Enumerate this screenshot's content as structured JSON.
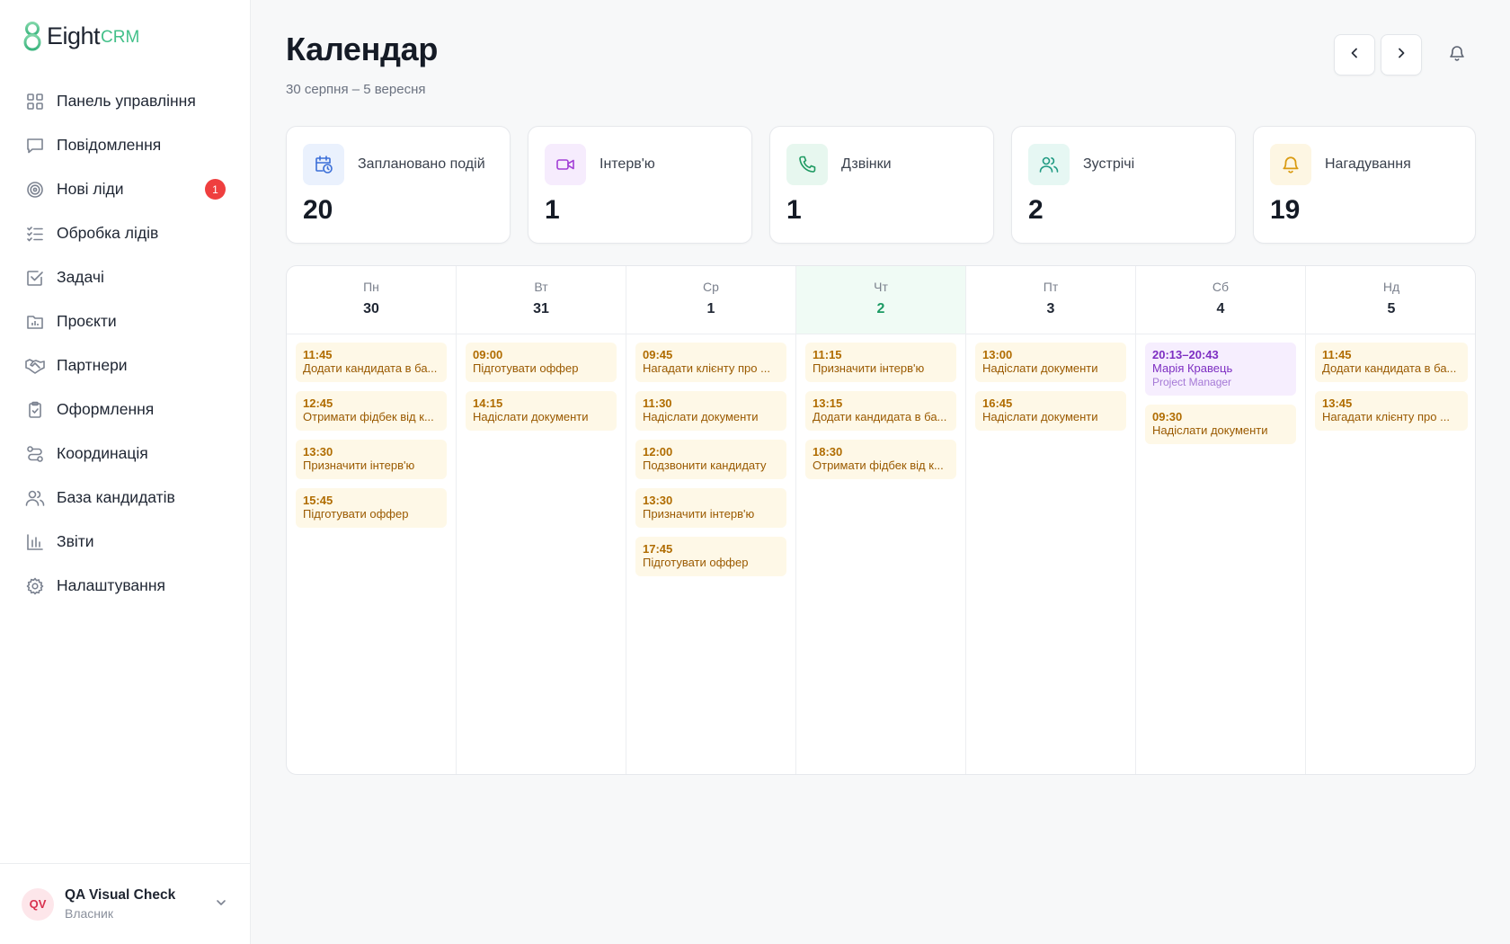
{
  "brand": {
    "name": "Eight",
    "suffix": "CRM",
    "accent": "#43c08a"
  },
  "sidebar": {
    "items": [
      {
        "label": "Панель управління",
        "icon": "grid-icon"
      },
      {
        "label": "Повідомлення",
        "icon": "message-icon"
      },
      {
        "label": "Нові ліди",
        "icon": "target-icon",
        "badge": "1"
      },
      {
        "label": "Обробка лідів",
        "icon": "checklist-icon"
      },
      {
        "label": "Задачі",
        "icon": "task-check-icon"
      },
      {
        "label": "Проєкти",
        "icon": "folder-chart-icon"
      },
      {
        "label": "Партнери",
        "icon": "handshake-icon"
      },
      {
        "label": "Оформлення",
        "icon": "clipboard-icon"
      },
      {
        "label": "Координація",
        "icon": "route-icon"
      },
      {
        "label": "База кандидатів",
        "icon": "users-icon"
      },
      {
        "label": "Звіти",
        "icon": "bar-chart-icon"
      },
      {
        "label": "Налаштування",
        "icon": "gear-icon"
      }
    ]
  },
  "user": {
    "initials": "QV",
    "name": "QA Visual Check",
    "role": "Власник"
  },
  "header": {
    "title": "Календар",
    "range": "30 серпня – 5 вересня"
  },
  "stats": [
    {
      "label": "Заплановано подій",
      "value": "20",
      "icon": "calendar-clock-icon",
      "color": "#3b6fd8",
      "bg": "#eaf1fd"
    },
    {
      "label": "Інтерв'ю",
      "value": "1",
      "icon": "video-icon",
      "color": "#a23fd6",
      "bg": "#f6ecfd"
    },
    {
      "label": "Дзвінки",
      "value": "1",
      "icon": "phone-icon",
      "color": "#1f9a62",
      "bg": "#e7f7ef"
    },
    {
      "label": "Зустрічі",
      "value": "2",
      "icon": "users-icon",
      "color": "#1f9a82",
      "bg": "#e6f7f3"
    },
    {
      "label": "Нагадування",
      "value": "19",
      "icon": "bell-icon",
      "color": "#d99a10",
      "bg": "#fdf6e3"
    }
  ],
  "calendar": {
    "today_index": 3,
    "days": [
      {
        "dow": "Пн",
        "num": "30",
        "events": [
          {
            "time": "11:45",
            "title": "Додати кандидата в ба..."
          },
          {
            "time": "12:45",
            "title": "Отримати фідбек від к..."
          },
          {
            "time": "13:30",
            "title": "Призначити інтерв'ю"
          },
          {
            "time": "15:45",
            "title": "Підготувати оффер"
          }
        ]
      },
      {
        "dow": "Вт",
        "num": "31",
        "events": [
          {
            "time": "09:00",
            "title": "Підготувати оффер"
          },
          {
            "time": "14:15",
            "title": "Надіслати документи"
          }
        ]
      },
      {
        "dow": "Ср",
        "num": "1",
        "events": [
          {
            "time": "09:45",
            "title": "Нагадати клієнту про ..."
          },
          {
            "time": "11:30",
            "title": "Надіслати документи"
          },
          {
            "time": "12:00",
            "title": "Подзвонити кандидату"
          },
          {
            "time": "13:30",
            "title": "Призначити інтерв'ю"
          },
          {
            "time": "17:45",
            "title": "Підготувати оффер"
          }
        ]
      },
      {
        "dow": "Чт",
        "num": "2",
        "events": [
          {
            "time": "11:15",
            "title": "Призначити інтерв'ю"
          },
          {
            "time": "13:15",
            "title": "Додати кандидата в ба..."
          },
          {
            "time": "18:30",
            "title": "Отримати фідбек від к..."
          }
        ]
      },
      {
        "dow": "Пт",
        "num": "3",
        "events": [
          {
            "time": "13:00",
            "title": "Надіслати документи"
          },
          {
            "time": "16:45",
            "title": "Надіслати документи"
          }
        ]
      },
      {
        "dow": "Сб",
        "num": "4",
        "events": [
          {
            "time": "20:13–20:43",
            "title": "Марія Кравець",
            "sub": "Project Manager",
            "kind": "meeting"
          },
          {
            "time": "09:30",
            "title": "Надіслати документи"
          }
        ]
      },
      {
        "dow": "Нд",
        "num": "5",
        "events": [
          {
            "time": "11:45",
            "title": "Додати кандидата в ба..."
          },
          {
            "time": "13:45",
            "title": "Нагадати клієнту про ..."
          }
        ]
      }
    ]
  }
}
